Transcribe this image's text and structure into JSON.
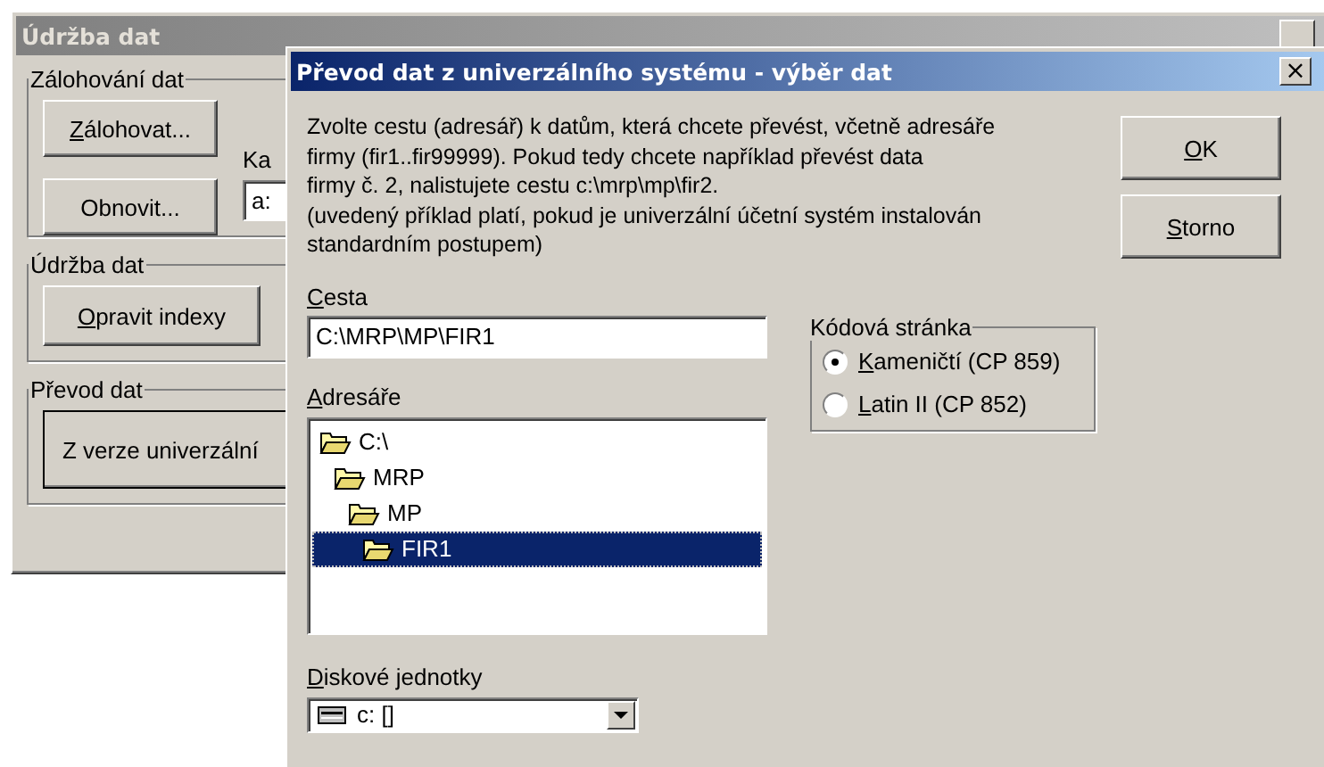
{
  "back_window": {
    "title": "Údržba dat",
    "backup_group": {
      "title": "Zálohování dat",
      "backup_button": {
        "label": "Zálohovat...",
        "mnemonic": true
      },
      "restore_button": {
        "label": "Obnovit...",
        "mnemonic": false
      },
      "drive_label": "Ka",
      "drive_value": "a:"
    },
    "maintenance_group": {
      "title": "Údržba dat",
      "repair_button": {
        "label": "Opravit indexy",
        "mnemonic": true
      }
    },
    "transfer_group": {
      "title": "Převod dat",
      "universal_button": {
        "label": "Z verze univerzální",
        "mnemonic": false
      }
    }
  },
  "dialog": {
    "title": "Převod dat z univerzálního systému - výběr dat",
    "close": "×",
    "instructions": [
      "Zvolte cestu (adresář) k datům, která chcete převést, včetně adresáře",
      "firmy (fir1..fir99999). Pokud tedy chcete například převést data",
      "firmy č. 2, nalistujete cestu c:\\mrp\\mp\\fir2.",
      "(uvedený příklad platí, pokud je univerzální účetní systém instalován",
      "standardním postupem)"
    ],
    "ok_button": {
      "label": "OK",
      "mnemonic": true
    },
    "cancel_button": {
      "label": "Storno",
      "mnemonic": true
    },
    "path_label": {
      "text": "Cesta",
      "mnemonic": true
    },
    "path_value": "C:\\MRP\\MP\\FIR1",
    "directories_label": {
      "text": "Adresáře",
      "mnemonic": true
    },
    "tree": [
      {
        "label": "C:\\",
        "selected": false,
        "children": [
          {
            "label": "MRP",
            "selected": false,
            "children": [
              {
                "label": "MP",
                "selected": false,
                "children": [
                  {
                    "label": "FIR1",
                    "selected": true
                  }
                ]
              }
            ]
          }
        ]
      }
    ],
    "drives_label": {
      "text": "Diskové jednotky",
      "mnemonic": true
    },
    "drive_value": "c: []",
    "codepage": {
      "title": "Kódová stránka",
      "options": [
        {
          "label": "Kameničtí (CP 859)",
          "mnemonic": true,
          "selected": true
        },
        {
          "label": "Latin II (CP 852)",
          "mnemonic": true,
          "selected": false
        }
      ]
    }
  }
}
